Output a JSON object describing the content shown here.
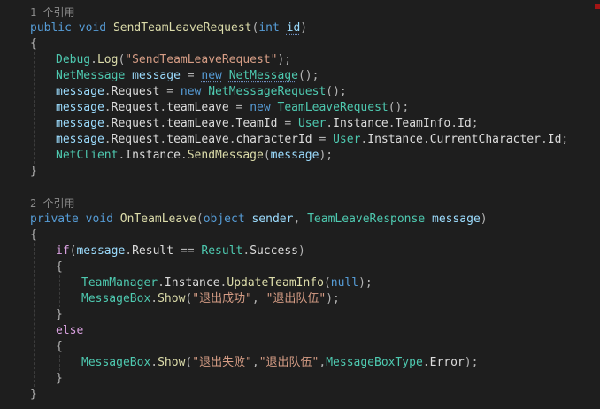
{
  "colors": {
    "background": "#1e1e1e",
    "keyword": "#569cd6",
    "control_keyword": "#d8a0df",
    "type": "#4ec9b0",
    "method": "#dcdcaa",
    "string": "#d69d85",
    "variable": "#9cdcfe",
    "codelens": "#8c8c8c"
  },
  "lines": [
    {
      "indent": 0,
      "tokens": [
        {
          "t": "1 个引用",
          "c": "lens"
        }
      ]
    },
    {
      "indent": 0,
      "tokens": [
        {
          "t": "public",
          "c": "kw"
        },
        {
          "t": " "
        },
        {
          "t": "void",
          "c": "kw"
        },
        {
          "t": " "
        },
        {
          "t": "SendTeamLeaveRequest",
          "c": "method"
        },
        {
          "t": "(",
          "c": "punc"
        },
        {
          "t": "int",
          "c": "kw"
        },
        {
          "t": " "
        },
        {
          "t": "id",
          "c": "var",
          "u": true
        },
        {
          "t": ")",
          "c": "punc"
        }
      ]
    },
    {
      "indent": 0,
      "tokens": [
        {
          "t": "{",
          "c": "punc"
        }
      ]
    },
    {
      "indent": 1,
      "tokens": [
        {
          "t": "Debug",
          "c": "type"
        },
        {
          "t": ".",
          "c": "punc"
        },
        {
          "t": "Log",
          "c": "method"
        },
        {
          "t": "(",
          "c": "punc"
        },
        {
          "t": "\"SendTeamLeaveRequest\"",
          "c": "str"
        },
        {
          "t": ");",
          "c": "punc"
        }
      ]
    },
    {
      "indent": 1,
      "tokens": [
        {
          "t": "NetMessage",
          "c": "type"
        },
        {
          "t": " "
        },
        {
          "t": "message",
          "c": "var"
        },
        {
          "t": " = ",
          "c": "punc"
        },
        {
          "t": "new",
          "c": "kw",
          "u": true
        },
        {
          "t": " "
        },
        {
          "t": "NetMessage",
          "c": "type",
          "u": true
        },
        {
          "t": "();",
          "c": "punc"
        }
      ]
    },
    {
      "indent": 1,
      "tokens": [
        {
          "t": "message",
          "c": "var"
        },
        {
          "t": ".",
          "c": "punc"
        },
        {
          "t": "Request",
          "c": "prop"
        },
        {
          "t": " = ",
          "c": "punc"
        },
        {
          "t": "new",
          "c": "kw"
        },
        {
          "t": " "
        },
        {
          "t": "NetMessageRequest",
          "c": "type"
        },
        {
          "t": "();",
          "c": "punc"
        }
      ]
    },
    {
      "indent": 1,
      "tokens": [
        {
          "t": "message",
          "c": "var"
        },
        {
          "t": ".",
          "c": "punc"
        },
        {
          "t": "Request",
          "c": "prop"
        },
        {
          "t": ".",
          "c": "punc"
        },
        {
          "t": "teamLeave",
          "c": "prop"
        },
        {
          "t": " = ",
          "c": "punc"
        },
        {
          "t": "new",
          "c": "kw"
        },
        {
          "t": " "
        },
        {
          "t": "TeamLeaveRequest",
          "c": "type"
        },
        {
          "t": "();",
          "c": "punc"
        }
      ]
    },
    {
      "indent": 1,
      "tokens": [
        {
          "t": "message",
          "c": "var"
        },
        {
          "t": ".",
          "c": "punc"
        },
        {
          "t": "Request",
          "c": "prop"
        },
        {
          "t": ".",
          "c": "punc"
        },
        {
          "t": "teamLeave",
          "c": "prop"
        },
        {
          "t": ".",
          "c": "punc"
        },
        {
          "t": "TeamId",
          "c": "prop"
        },
        {
          "t": " = ",
          "c": "punc"
        },
        {
          "t": "User",
          "c": "type"
        },
        {
          "t": ".",
          "c": "punc"
        },
        {
          "t": "Instance",
          "c": "prop"
        },
        {
          "t": ".",
          "c": "punc"
        },
        {
          "t": "TeamInfo",
          "c": "prop"
        },
        {
          "t": ".",
          "c": "punc"
        },
        {
          "t": "Id",
          "c": "prop"
        },
        {
          "t": ";",
          "c": "punc"
        }
      ]
    },
    {
      "indent": 1,
      "tokens": [
        {
          "t": "message",
          "c": "var"
        },
        {
          "t": ".",
          "c": "punc"
        },
        {
          "t": "Request",
          "c": "prop"
        },
        {
          "t": ".",
          "c": "punc"
        },
        {
          "t": "teamLeave",
          "c": "prop"
        },
        {
          "t": ".",
          "c": "punc"
        },
        {
          "t": "characterId",
          "c": "prop"
        },
        {
          "t": " = ",
          "c": "punc"
        },
        {
          "t": "User",
          "c": "type"
        },
        {
          "t": ".",
          "c": "punc"
        },
        {
          "t": "Instance",
          "c": "prop"
        },
        {
          "t": ".",
          "c": "punc"
        },
        {
          "t": "CurrentCharacter",
          "c": "prop"
        },
        {
          "t": ".",
          "c": "punc"
        },
        {
          "t": "Id",
          "c": "prop"
        },
        {
          "t": ";",
          "c": "punc"
        }
      ]
    },
    {
      "indent": 1,
      "tokens": [
        {
          "t": "NetClient",
          "c": "type"
        },
        {
          "t": ".",
          "c": "punc"
        },
        {
          "t": "Instance",
          "c": "prop"
        },
        {
          "t": ".",
          "c": "punc"
        },
        {
          "t": "SendMessage",
          "c": "method"
        },
        {
          "t": "(",
          "c": "punc"
        },
        {
          "t": "message",
          "c": "var"
        },
        {
          "t": ");",
          "c": "punc"
        }
      ]
    },
    {
      "indent": 0,
      "tokens": [
        {
          "t": "}",
          "c": "punc"
        }
      ]
    },
    {
      "indent": 0,
      "tokens": []
    },
    {
      "indent": 0,
      "tokens": [
        {
          "t": "2 个引用",
          "c": "lens"
        }
      ]
    },
    {
      "indent": 0,
      "tokens": [
        {
          "t": "private",
          "c": "kw"
        },
        {
          "t": " "
        },
        {
          "t": "void",
          "c": "kw"
        },
        {
          "t": " "
        },
        {
          "t": "OnTeamLeave",
          "c": "method"
        },
        {
          "t": "(",
          "c": "punc"
        },
        {
          "t": "object",
          "c": "kw"
        },
        {
          "t": " "
        },
        {
          "t": "sender",
          "c": "var"
        },
        {
          "t": ", ",
          "c": "punc"
        },
        {
          "t": "TeamLeaveResponse",
          "c": "type"
        },
        {
          "t": " "
        },
        {
          "t": "message",
          "c": "var"
        },
        {
          "t": ")",
          "c": "punc"
        }
      ]
    },
    {
      "indent": 0,
      "tokens": [
        {
          "t": "{",
          "c": "punc"
        }
      ]
    },
    {
      "indent": 1,
      "tokens": [
        {
          "t": "if",
          "c": "ctl"
        },
        {
          "t": "(",
          "c": "punc"
        },
        {
          "t": "message",
          "c": "var"
        },
        {
          "t": ".",
          "c": "punc"
        },
        {
          "t": "Result",
          "c": "prop"
        },
        {
          "t": " == ",
          "c": "punc"
        },
        {
          "t": "Result",
          "c": "type"
        },
        {
          "t": ".",
          "c": "punc"
        },
        {
          "t": "Success",
          "c": "prop"
        },
        {
          "t": ")",
          "c": "punc"
        }
      ]
    },
    {
      "indent": 1,
      "tokens": [
        {
          "t": "{",
          "c": "punc"
        }
      ]
    },
    {
      "indent": 2,
      "tokens": [
        {
          "t": "TeamManager",
          "c": "type"
        },
        {
          "t": ".",
          "c": "punc"
        },
        {
          "t": "Instance",
          "c": "prop"
        },
        {
          "t": ".",
          "c": "punc"
        },
        {
          "t": "UpdateTeamInfo",
          "c": "method"
        },
        {
          "t": "(",
          "c": "punc"
        },
        {
          "t": "null",
          "c": "kw"
        },
        {
          "t": ");",
          "c": "punc"
        }
      ]
    },
    {
      "indent": 2,
      "tokens": [
        {
          "t": "MessageBox",
          "c": "type"
        },
        {
          "t": ".",
          "c": "punc"
        },
        {
          "t": "Show",
          "c": "method"
        },
        {
          "t": "(",
          "c": "punc"
        },
        {
          "t": "\"退出成功\"",
          "c": "str"
        },
        {
          "t": ", ",
          "c": "punc"
        },
        {
          "t": "\"退出队伍\"",
          "c": "str"
        },
        {
          "t": ");",
          "c": "punc"
        }
      ]
    },
    {
      "indent": 1,
      "tokens": [
        {
          "t": "}",
          "c": "punc"
        }
      ]
    },
    {
      "indent": 1,
      "tokens": [
        {
          "t": "else",
          "c": "ctl"
        }
      ]
    },
    {
      "indent": 1,
      "tokens": [
        {
          "t": "{",
          "c": "punc"
        }
      ]
    },
    {
      "indent": 2,
      "tokens": [
        {
          "t": "MessageBox",
          "c": "type"
        },
        {
          "t": ".",
          "c": "punc"
        },
        {
          "t": "Show",
          "c": "method"
        },
        {
          "t": "(",
          "c": "punc"
        },
        {
          "t": "\"退出失败\"",
          "c": "str"
        },
        {
          "t": ",",
          "c": "punc"
        },
        {
          "t": "\"退出队伍\"",
          "c": "str"
        },
        {
          "t": ",",
          "c": "punc"
        },
        {
          "t": "MessageBoxType",
          "c": "type"
        },
        {
          "t": ".",
          "c": "punc"
        },
        {
          "t": "Error",
          "c": "prop"
        },
        {
          "t": ");",
          "c": "punc"
        }
      ]
    },
    {
      "indent": 1,
      "tokens": [
        {
          "t": "}",
          "c": "punc"
        }
      ]
    },
    {
      "indent": 0,
      "tokens": [
        {
          "t": "}",
          "c": "punc"
        }
      ]
    }
  ]
}
